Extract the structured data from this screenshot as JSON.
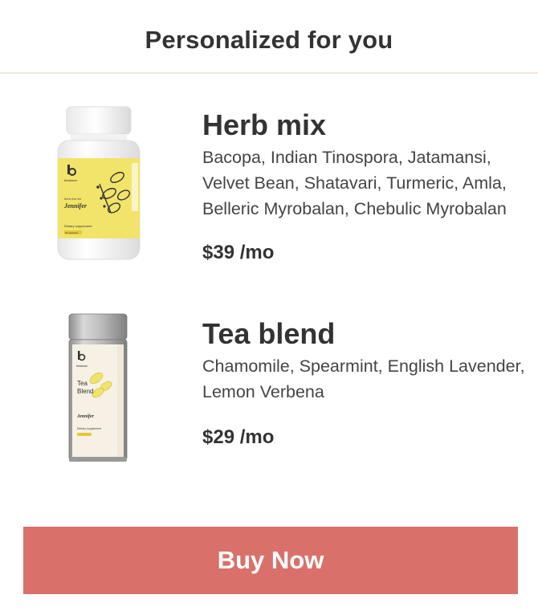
{
  "header": {
    "title": "Personalized for you"
  },
  "products": [
    {
      "name": "Herb mix",
      "ingredients": "Bacopa, Indian Tinospora, Jatamansi, Velvet Bean, Shatavari, Turmeric, Amla, Belleric Myrobalan, Chebulic Myrobalan",
      "price": "$39 /mo",
      "image": {
        "icon": "supplement-bottle",
        "brand": "bbalance",
        "label_line1": "herb mix for",
        "label_name": "Jennifer",
        "label_type": "Dietary supplement",
        "label_count": "60 capsules",
        "accent_color": "#f2e36b"
      }
    },
    {
      "name": "Tea blend",
      "ingredients": "Chamomile, Spearmint, English Lavender, Lemon Verbena",
      "price": "$29 /mo",
      "image": {
        "icon": "tea-tin",
        "brand": "bbalance",
        "label_line1": "Tea",
        "label_line2": "Blend",
        "label_name": "Jennifer",
        "label_type": "Dietary supplement",
        "accent_color": "#f2e36b"
      }
    }
  ],
  "cta": {
    "label": "Buy Now",
    "color": "#d9716a"
  }
}
